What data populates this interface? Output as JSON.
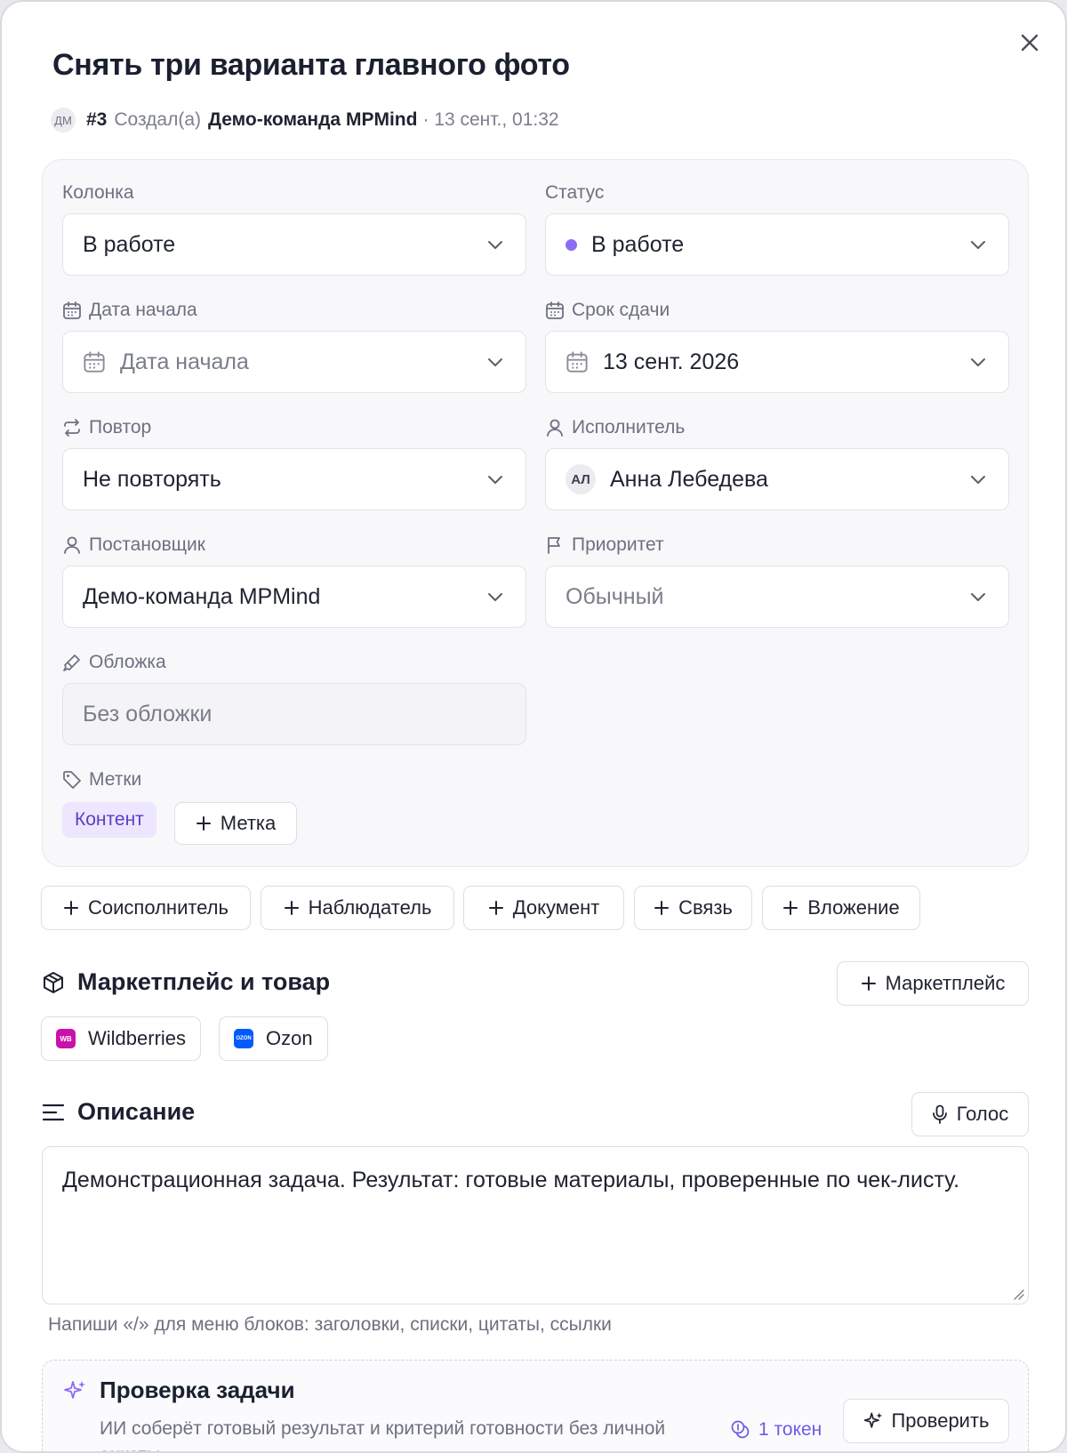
{
  "task": {
    "title": "Снять три варианта главного фото",
    "author_initials": "ДМ",
    "number": "#3",
    "created_by_label": "Создал(а)",
    "author": "Демо-команда MPMind",
    "created_at": "· 13 сент., 01:32"
  },
  "fields": {
    "column": {
      "label": "Колонка",
      "value": "В работе"
    },
    "status": {
      "label": "Статус",
      "value": "В работе",
      "dot_color": "#8b6cf6"
    },
    "start_date": {
      "label": "Дата начала",
      "placeholder": "Дата начала"
    },
    "due_date": {
      "label": "Срок сдачи",
      "value": "13 сент. 2026"
    },
    "repeat": {
      "label": "Повтор",
      "value": "Не повторять"
    },
    "assignee": {
      "label": "Исполнитель",
      "initials": "АЛ",
      "value": "Анна Лебедева"
    },
    "reporter": {
      "label": "Постановщик",
      "value": "Демо-команда MPMind"
    },
    "priority": {
      "label": "Приоритет",
      "value": "Обычный"
    },
    "cover": {
      "label": "Обложка",
      "value": "Без обложки"
    },
    "tags": {
      "label": "Метки",
      "items": [
        "Контент"
      ],
      "add_label": "Метка"
    }
  },
  "actions": {
    "co_assignee": "Соисполнитель",
    "observer": "Наблюдатель",
    "document": "Документ",
    "link": "Связь",
    "attachment": "Вложение"
  },
  "marketplace": {
    "title": "Маркетплейс и товар",
    "add_label": "Маркетплейс",
    "items": [
      {
        "name": "Wildberries",
        "logo_text": "WB",
        "color": "#cb11ab"
      },
      {
        "name": "Ozon",
        "logo_text": "OZON",
        "color": "#005bff"
      }
    ]
  },
  "description": {
    "title": "Описание",
    "voice_label": "Голос",
    "text": "Демонстрационная задача. Результат: готовые материалы, проверенные по чек-листу.",
    "hint": "Напиши «/» для меню блоков: заголовки, списки, цитаты, ссылки"
  },
  "check": {
    "title": "Проверка задачи",
    "desc": "ИИ соберёт готовый результат и критерий готовности без личной анкеты",
    "token": "1 токен",
    "button": "Проверить"
  },
  "colors": {
    "accent": "#8b6cf6",
    "tag_bg": "#ece6fe",
    "tag_text": "#5a3fc7",
    "token_text": "#6b5ce7"
  }
}
